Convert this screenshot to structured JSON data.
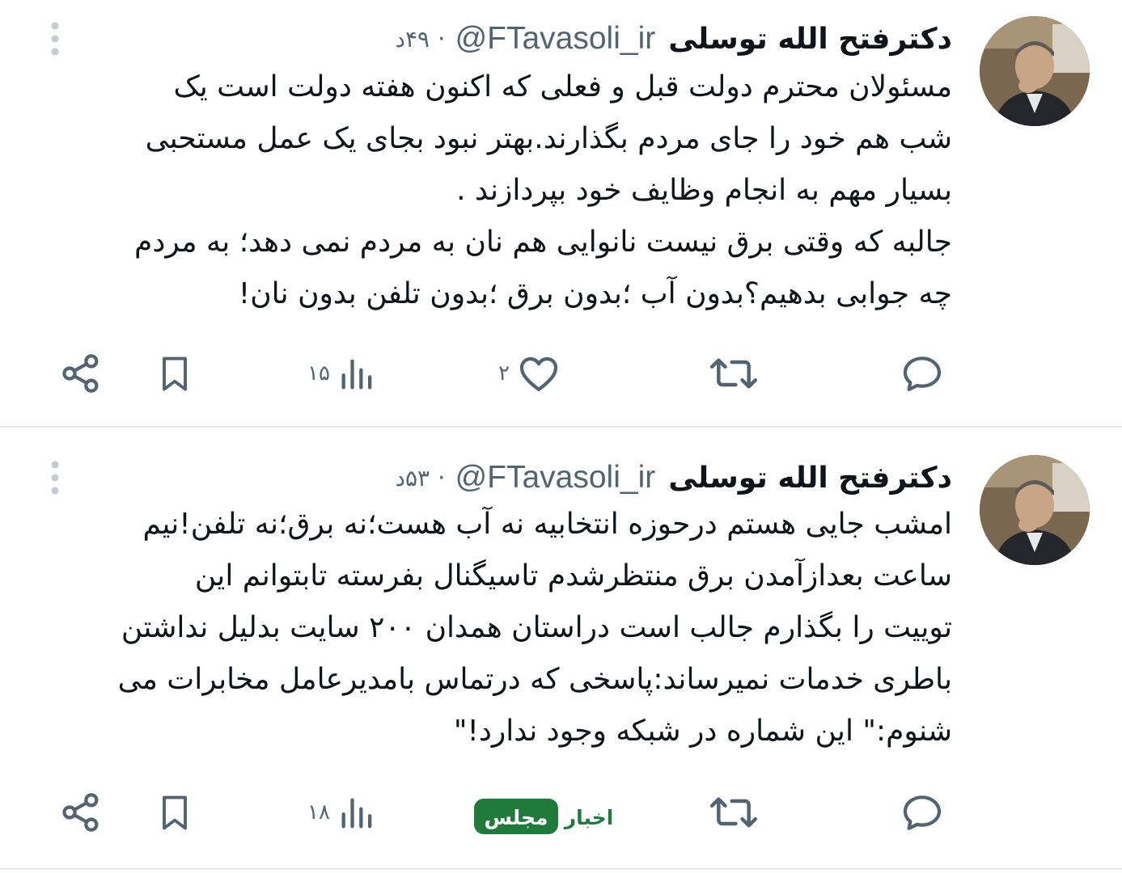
{
  "tweets": [
    {
      "author": "دکترفتح الله توسلی",
      "handle": "@FTavasoli_ir",
      "separator": "·",
      "time": "۴۹د",
      "text_lines": [
        "مسئولان محترم دولت قبل و فعلی که اکنون هفته دولت است یک",
        "شب هم خود را جای مردم بگذارند.بهتر نبود بجای یک عمل مستحبی",
        "بسیار مهم به انجام وظایف خود بپردازند .",
        "جالبه که وقتی برق نیست نانوایی هم نان به مردم نمی دهد؛ به مردم",
        "چه جوابی بدهیم؟بدون آب ؛بدون برق ؛بدون تلفن بدون  نان!"
      ],
      "likes": "۲",
      "views": "۱۵",
      "icons": {
        "reply": "reply-bubble-icon",
        "retweet": "retweet-icon",
        "like": "heart-icon",
        "views": "bar-chart-icon",
        "bookmark": "bookmark-icon",
        "share": "share-icon",
        "more": "vertical-dots-icon"
      }
    },
    {
      "author": "دکترفتح الله توسلی",
      "handle": "@FTavasoli_ir",
      "separator": "·",
      "time": "۵۳د",
      "text_lines": [
        "امشب جایی هستم درحوزه انتخابیه نه آب هست؛نه برق؛نه تلفن!نیم",
        "ساعت بعدازآمدن برق منتظرشدم تاسیگنال بفرسته تابتوانم این",
        "توییت را بگذارم جالب است دراستان همدان ۲۰۰ سایت بدلیل نداشتن",
        "باطری خدمات نمیرساند:پاسخی که درتماس بامدیرعامل مخابرات می",
        "شنوم:\" این شماره در شبکه وجود ندارد!\""
      ],
      "views": "۱۸",
      "icons": {
        "reply": "reply-bubble-icon",
        "retweet": "retweet-icon",
        "views": "bar-chart-icon",
        "bookmark": "bookmark-icon",
        "share": "share-icon",
        "more": "vertical-dots-icon"
      }
    }
  ],
  "watermark": {
    "text_part1": "اخبار",
    "text_part2": "مجلس",
    "color": "#1f7a3c"
  },
  "colors": {
    "text": "#0f1419",
    "secondary": "#536471",
    "divider": "#e6e9ec",
    "more_dots": "#c4cbd1"
  }
}
